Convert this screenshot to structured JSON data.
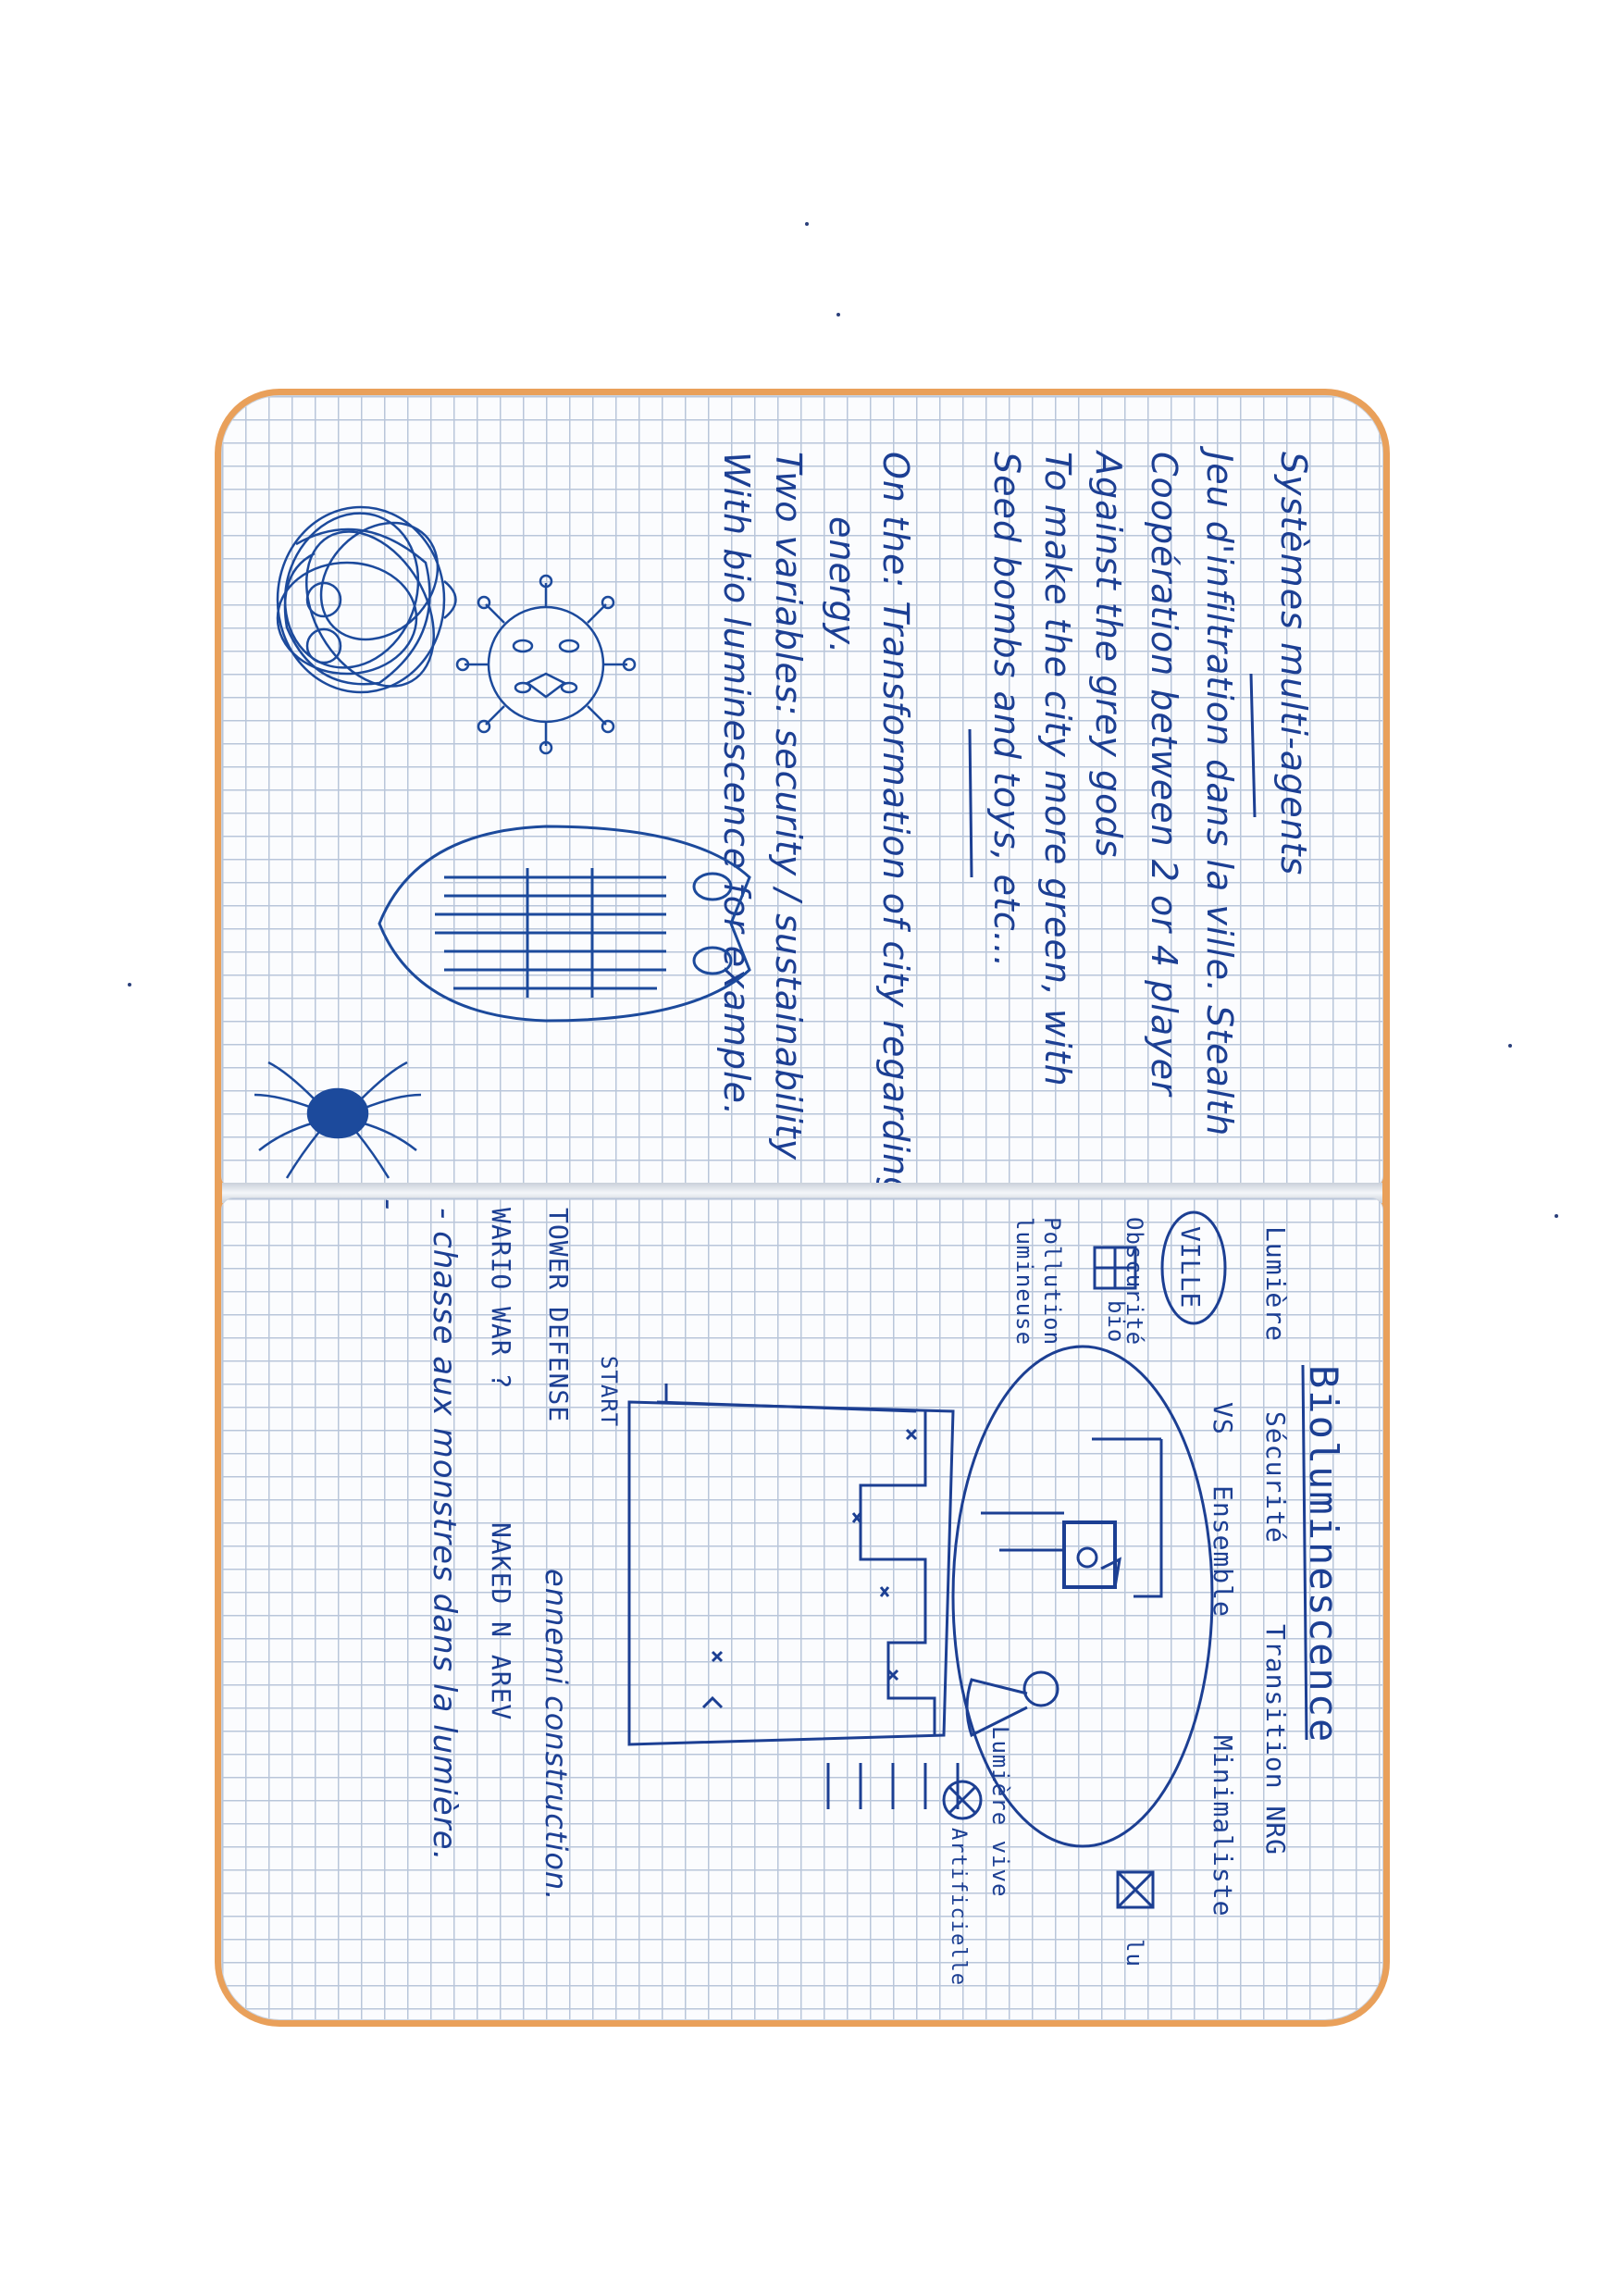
{
  "top_page": {
    "title": "Systèmes multi-agents",
    "lines": [
      "Jeu d'infiltration dans la ville. Stealth",
      "Coopération between 2 or 4 player",
      "Against the grey gods",
      "To make the city more green, with",
      "Seed bombs and toys, etc...",
      "On the: Transformation of city regarding",
      "energy.",
      "Two variables: security / sustainability",
      "With bio luminescence for example."
    ]
  },
  "bottom_page": {
    "title": "Bioluminescence",
    "heading_row": {
      "col1": "Lumière",
      "col2": "Sécurité",
      "col3": "Transition NRG"
    },
    "subheading_row": {
      "col1": "VS",
      "col2": "Ensemble",
      "col3": "Minimaliste"
    },
    "ville_label": "VILLE",
    "obscurite_label": "Obscurité",
    "bio_label": "bio",
    "lu_label": "lu",
    "pollution_label": "Pollution lumineuse",
    "lumiere_vive_label": "Lumière vive",
    "artificielle_label": "Artificielle",
    "start_label": "START",
    "tower_defense": "TOWER DEFENSE",
    "ennemi": "ennemi construction.",
    "wario_war": "WARIO WAR ?",
    "naked_n_arev": "NAKED N AREV",
    "chasse": "- chasse aux monstres dans la lumière.",
    "dash": "-"
  },
  "colors": {
    "ink": "#1c3f93",
    "grid": "#b9c6da",
    "cover": "#e9a05a"
  }
}
